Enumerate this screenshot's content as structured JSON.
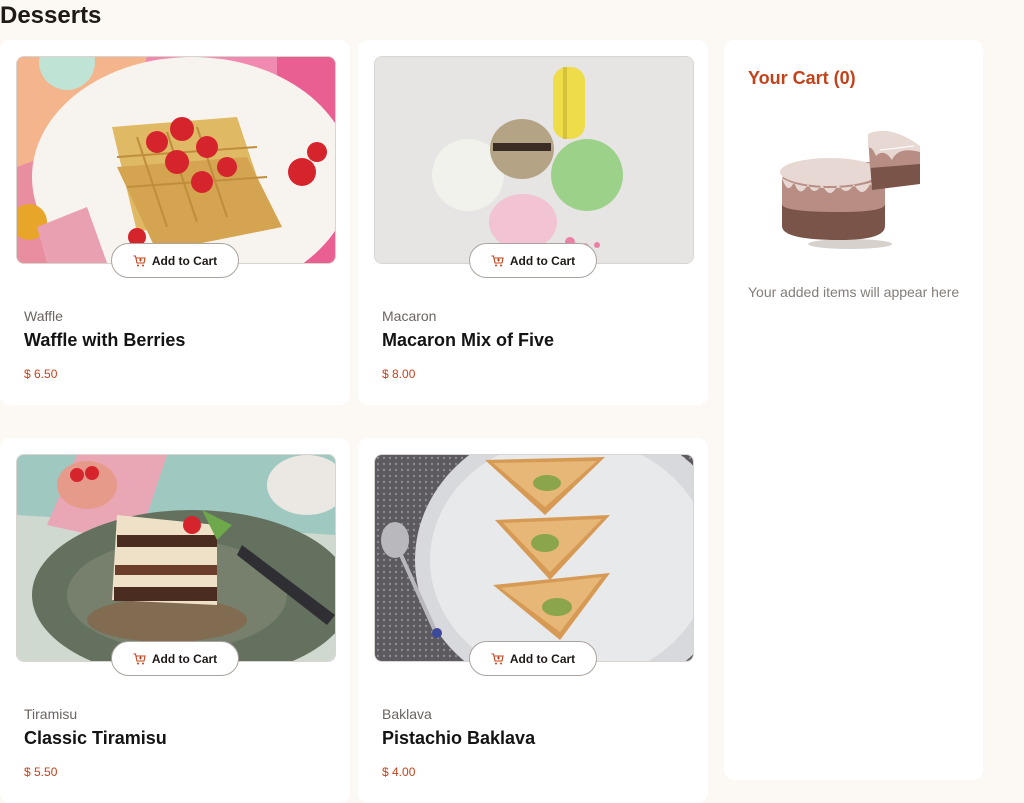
{
  "page": {
    "title": "Desserts"
  },
  "products": [
    {
      "category": "Waffle",
      "name": "Waffle with Berries",
      "price": "$ 6.50",
      "add_label": "Add to Cart",
      "image": "waffle-photo"
    },
    {
      "category": "Macaron",
      "name": "Macaron Mix of Five",
      "price": "$ 8.00",
      "add_label": "Add to Cart",
      "image": "macaron-photo"
    },
    {
      "category": "Tiramisu",
      "name": "Classic Tiramisu",
      "price": "$ 5.50",
      "add_label": "Add to Cart",
      "image": "tiramisu-photo"
    },
    {
      "category": "Baklava",
      "name": "Pistachio Baklava",
      "price": "$ 4.00",
      "add_label": "Add to Cart",
      "image": "baklava-photo"
    }
  ],
  "cart": {
    "title": "Your Cart (0)",
    "empty_message": "Your added items will appear here",
    "illustration": "empty-cake-illustration"
  },
  "colors": {
    "accent": "#c4421b",
    "background": "#fcf8f3",
    "card": "#ffffff"
  },
  "icons": {
    "add_to_cart": "cart-plus-icon"
  }
}
